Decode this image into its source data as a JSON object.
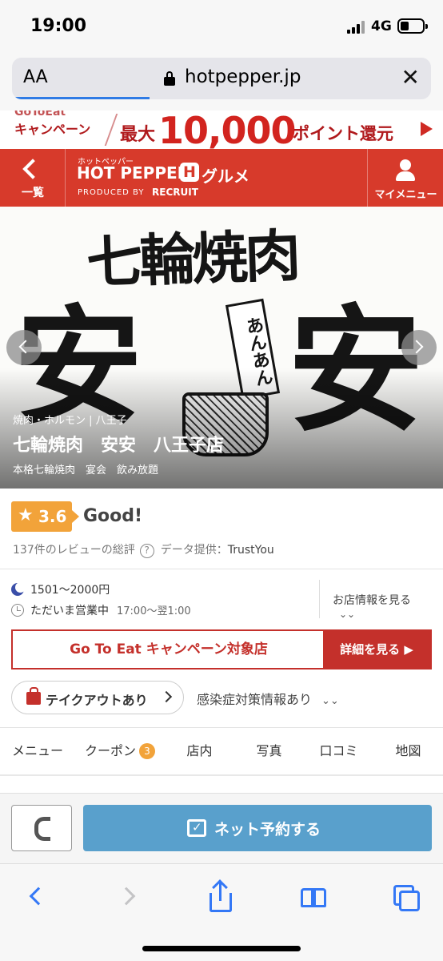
{
  "status_bar": {
    "time": "19:00",
    "network": "4G"
  },
  "browser": {
    "text_size_label": "AA",
    "url": "hotpepper.jp",
    "close_glyph": "✕"
  },
  "campaign_banner": {
    "line1": "GoToEat",
    "line2": "キャンペーン",
    "prefix": "最大",
    "amount": "10,000",
    "suffix": "ポイント還元"
  },
  "header": {
    "back_label": "一覧",
    "logo_kana": "ホットペッパー",
    "logo_main": "HOT PEPPER",
    "logo_h": "H",
    "logo_gurume": "グルメ",
    "produced_by": "PRODUCED BY",
    "recruit": "RECRUIT",
    "my_menu_label": "マイメニュー"
  },
  "hero": {
    "calligraphy_top": "七輪焼肉",
    "calligraphy_left": "安",
    "calligraphy_right": "安",
    "sign_text": "あんあん",
    "genre": "焼肉・ホルモン | 八王子",
    "shop_name": "七輪焼肉　安安　八王子店",
    "tags": "本格七輪焼肉　宴会　飲み放題"
  },
  "rating": {
    "star": "★",
    "score": "3.6",
    "label": "Good!",
    "review_summary": "137件のレビューの総評",
    "help_glyph": "?",
    "provider_label": "データ提供：",
    "provider": "TrustYou"
  },
  "info": {
    "budget": "1501〜2000円",
    "open_status": "ただいま営業中",
    "hours": "17:00〜翌1:00",
    "shop_info_link": "お店情報を見る",
    "expand_glyph": "⌄⌄"
  },
  "goto_eat": {
    "text": "Go To Eat キャンペーン対象店",
    "button": "詳細を見る ▶"
  },
  "takeout": {
    "label": "テイクアウトあり"
  },
  "covid": {
    "label": "感染症対策情報あり",
    "expand_glyph": "⌄⌄"
  },
  "tabs": [
    {
      "label": "メニュー"
    },
    {
      "label": "クーポン",
      "count": "3"
    },
    {
      "label": "店内"
    },
    {
      "label": "写真"
    },
    {
      "label": "口コミ"
    },
    {
      "label": "地図"
    }
  ],
  "action_bar": {
    "reserve_label": "ネット予約する"
  },
  "colors": {
    "brand_red": "#d73a2b",
    "campaign_red": "#c4302b",
    "rating_orange": "#f2a33a",
    "reserve_blue": "#59a0cc",
    "safari_blue": "#3478f6"
  }
}
